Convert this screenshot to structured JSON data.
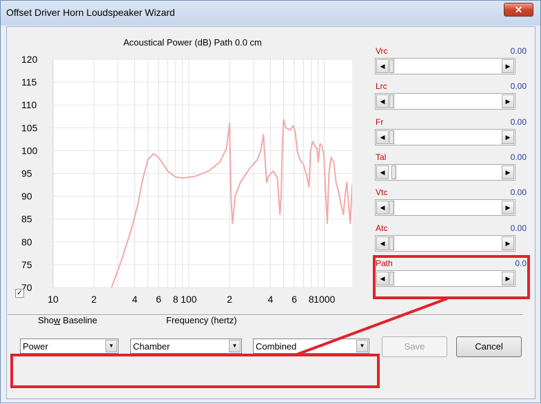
{
  "window": {
    "title": "Offset Driver Horn Loudspeaker Wizard",
    "close_glyph": "✕"
  },
  "chart_data": {
    "type": "line",
    "title": "Acoustical Power (dB)   Path 0.0 cm",
    "xlabel": "Frequency (hertz)",
    "ylabel": "",
    "x_scale": "log",
    "xlim": [
      10,
      2000
    ],
    "ylim": [
      70,
      120
    ],
    "y_ticks": [
      "120",
      "115",
      "110",
      "105",
      "100",
      "95",
      "90",
      "85",
      "80",
      "75",
      "70"
    ],
    "x_ticks": [
      {
        "v": 10,
        "label": "10"
      },
      {
        "v": 20,
        "label": "2"
      },
      {
        "v": 40,
        "label": "4"
      },
      {
        "v": 60,
        "label": "6"
      },
      {
        "v": 80,
        "label": "8"
      },
      {
        "v": 100,
        "label": "100"
      },
      {
        "v": 200,
        "label": "2"
      },
      {
        "v": 400,
        "label": "4"
      },
      {
        "v": 600,
        "label": "6"
      },
      {
        "v": 800,
        "label": "8"
      },
      {
        "v": 1000,
        "label": "1000"
      },
      {
        "v": 2000,
        "label": "2"
      }
    ],
    "grid_x_lines": [
      20,
      30,
      40,
      50,
      60,
      70,
      80,
      90,
      100,
      200,
      300,
      400,
      500,
      600,
      700,
      800,
      900,
      1000
    ],
    "grid": true,
    "series": [
      {
        "color": "#f2a9a9",
        "points": [
          [
            27,
            70
          ],
          [
            32,
            76
          ],
          [
            38,
            83
          ],
          [
            42,
            88
          ],
          [
            46,
            94
          ],
          [
            50,
            98
          ],
          [
            55,
            99.3
          ],
          [
            60,
            98.5
          ],
          [
            70,
            95.5
          ],
          [
            80,
            94.2
          ],
          [
            90,
            94
          ],
          [
            110,
            94.3
          ],
          [
            140,
            95.5
          ],
          [
            170,
            97.5
          ],
          [
            190,
            100.5
          ],
          [
            200,
            106
          ],
          [
            205,
            90
          ],
          [
            210,
            84
          ],
          [
            220,
            90
          ],
          [
            240,
            93
          ],
          [
            280,
            96
          ],
          [
            320,
            98
          ],
          [
            340,
            100
          ],
          [
            355,
            103.5
          ],
          [
            365,
            98
          ],
          [
            375,
            93
          ],
          [
            390,
            94.5
          ],
          [
            420,
            95.5
          ],
          [
            450,
            94
          ],
          [
            470,
            86
          ],
          [
            480,
            90
          ],
          [
            490,
            101
          ],
          [
            500,
            106.8
          ],
          [
            520,
            105
          ],
          [
            560,
            104.5
          ],
          [
            590,
            105.5
          ],
          [
            610,
            104
          ],
          [
            630,
            100
          ],
          [
            660,
            98
          ],
          [
            700,
            97
          ],
          [
            740,
            94.5
          ],
          [
            770,
            92
          ],
          [
            790,
            100
          ],
          [
            820,
            102
          ],
          [
            850,
            101
          ],
          [
            880,
            100.5
          ],
          [
            900,
            97.5
          ],
          [
            930,
            101.5
          ],
          [
            960,
            101
          ],
          [
            990,
            99
          ],
          [
            1030,
            88.5
          ],
          [
            1050,
            84
          ],
          [
            1080,
            95
          ],
          [
            1120,
            98.5
          ],
          [
            1170,
            97.5
          ],
          [
            1220,
            93
          ],
          [
            1270,
            91
          ],
          [
            1320,
            88.5
          ],
          [
            1380,
            86
          ],
          [
            1420,
            90
          ],
          [
            1460,
            93
          ],
          [
            1510,
            88
          ],
          [
            1550,
            84
          ],
          [
            1600,
            92
          ],
          [
            1680,
            96
          ],
          [
            1750,
            89
          ],
          [
            1850,
            83
          ],
          [
            1920,
            88
          ],
          [
            2000,
            89
          ]
        ]
      }
    ]
  },
  "show_baseline": {
    "label": "Show Baseline",
    "checked": true,
    "check_glyph": "✓"
  },
  "sliders": [
    {
      "name": "Vrc",
      "value": "0.00",
      "position": 0.0
    },
    {
      "name": "Lrc",
      "value": "0.00",
      "position": 0.0
    },
    {
      "name": "Fr",
      "value": "0.00",
      "position": 0.0
    },
    {
      "name": "Tal",
      "value": "0.00",
      "position": 0.02
    },
    {
      "name": "Vtc",
      "value": "0.00",
      "position": 0.0
    },
    {
      "name": "Atc",
      "value": "0.00",
      "position": 0.0
    },
    {
      "name": "Path",
      "value": "0.0",
      "position": 0.0
    }
  ],
  "arrows": {
    "left": "◀",
    "right": "▶",
    "down": "▼"
  },
  "dropdowns": [
    {
      "value": "Power"
    },
    {
      "value": "Chamber"
    },
    {
      "value": "Combined"
    }
  ],
  "buttons": {
    "save": "Save",
    "cancel": "Cancel"
  },
  "highlight_color": "#e2222a"
}
